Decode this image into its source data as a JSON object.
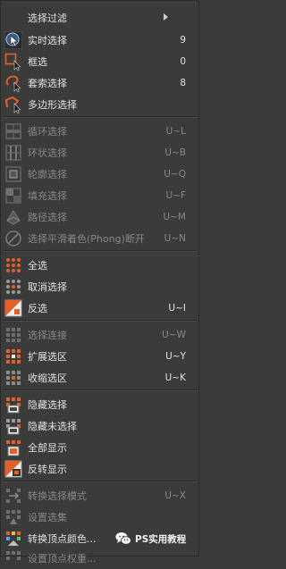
{
  "menu": {
    "items": [
      {
        "label": "选择过滤",
        "shortcut": "",
        "icon": "none",
        "submenu": true
      },
      {
        "label": "实时选择",
        "shortcut": "9",
        "icon": "live-selection-icon"
      },
      {
        "label": "框选",
        "shortcut": "0",
        "icon": "rectangle-selection-icon"
      },
      {
        "label": "套索选择",
        "shortcut": "8",
        "icon": "lasso-selection-icon"
      },
      {
        "label": "多边形选择",
        "shortcut": "",
        "icon": "polygon-selection-icon"
      },
      {
        "label": "循环选择",
        "shortcut": "U~L",
        "icon": "loop-selection-icon",
        "disabled": true
      },
      {
        "label": "环状选择",
        "shortcut": "U~B",
        "icon": "ring-selection-icon",
        "disabled": true
      },
      {
        "label": "轮廓选择",
        "shortcut": "U~Q",
        "icon": "outline-selection-icon",
        "disabled": true
      },
      {
        "label": "填充选择",
        "shortcut": "U~F",
        "icon": "fill-selection-icon",
        "disabled": true
      },
      {
        "label": "路径选择",
        "shortcut": "U~M",
        "icon": "path-selection-icon",
        "disabled": true
      },
      {
        "label": "选择平滑着色(Phong)断开",
        "shortcut": "U~N",
        "icon": "phong-break-selection-icon",
        "disabled": true
      },
      {
        "label": "全选",
        "shortcut": "",
        "icon": "select-all-icon"
      },
      {
        "label": "取消选择",
        "shortcut": "",
        "icon": "deselect-all-icon"
      },
      {
        "label": "反选",
        "shortcut": "U~I",
        "icon": "invert-selection-icon"
      },
      {
        "label": "选择连接",
        "shortcut": "U~W",
        "icon": "select-connected-icon",
        "disabled": true
      },
      {
        "label": "扩展选区",
        "shortcut": "U~Y",
        "icon": "grow-selection-icon"
      },
      {
        "label": "收缩选区",
        "shortcut": "U~K",
        "icon": "shrink-selection-icon"
      },
      {
        "label": "隐藏选择",
        "shortcut": "",
        "icon": "hide-selected-icon"
      },
      {
        "label": "隐藏未选择",
        "shortcut": "",
        "icon": "hide-unselected-icon"
      },
      {
        "label": "全部显示",
        "shortcut": "",
        "icon": "unhide-all-icon"
      },
      {
        "label": "反转显示",
        "shortcut": "",
        "icon": "invert-visibility-icon"
      },
      {
        "label": "转换选择模式",
        "shortcut": "U~X",
        "icon": "convert-selection-icon",
        "disabled": true
      },
      {
        "label": "设置选集",
        "shortcut": "",
        "icon": "set-selection-icon",
        "disabled": true
      },
      {
        "label": "转换顶点颜色...",
        "shortcut": "",
        "icon": "convert-vertex-color-icon"
      },
      {
        "label": "设置顶点权重...",
        "shortcut": "",
        "icon": "set-vertex-weight-icon",
        "disabled": true
      }
    ]
  },
  "watermark": {
    "text": "PS实用教程",
    "icon": "wechat-icon"
  },
  "colors": {
    "background": "#3b3b3b",
    "text": "#e2e2e2",
    "disabled_text": "#878787",
    "accent_orange": "#e0622a",
    "accent_blue": "#5aa0e6"
  }
}
